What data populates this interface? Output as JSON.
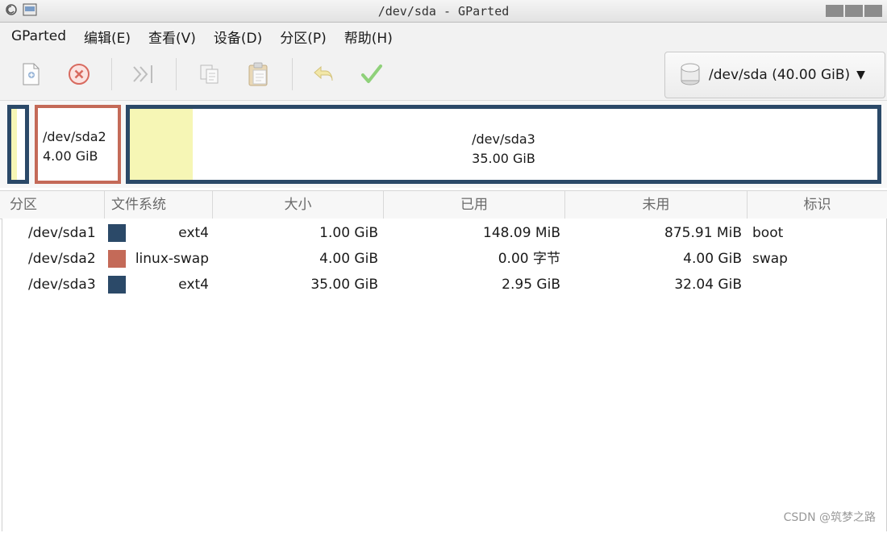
{
  "window": {
    "title": "/dev/sda - GParted"
  },
  "menu": {
    "items": [
      "GParted",
      "编辑(E)",
      "查看(V)",
      "设备(D)",
      "分区(P)",
      "帮助(H)"
    ]
  },
  "toolbar": {
    "buttons": [
      {
        "name": "new-partition",
        "icon": "new-icon"
      },
      {
        "name": "delete-partition",
        "icon": "delete-icon"
      },
      {
        "name": "resize-move",
        "icon": "resize-icon"
      },
      {
        "name": "copy",
        "icon": "copy-icon"
      },
      {
        "name": "paste",
        "icon": "paste-icon"
      },
      {
        "name": "undo",
        "icon": "undo-icon"
      },
      {
        "name": "apply",
        "icon": "apply-icon"
      }
    ]
  },
  "device": {
    "label": "/dev/sda (40.00 GiB)"
  },
  "disk_map": {
    "sda2": {
      "name": "/dev/sda2",
      "size": "4.00 GiB"
    },
    "sda3": {
      "name": "/dev/sda3",
      "size": "35.00 GiB"
    }
  },
  "columns": [
    "分区",
    "文件系统",
    "大小",
    "已用",
    "未用",
    "标识"
  ],
  "partitions": [
    {
      "partition": "/dev/sda1",
      "fs": "ext4",
      "color": "#2b4968",
      "size": "1.00 GiB",
      "used": "148.09 MiB",
      "unused": "875.91 MiB",
      "flags": "boot"
    },
    {
      "partition": "/dev/sda2",
      "fs": "linux-swap",
      "color": "#c46a58",
      "size": "4.00 GiB",
      "used": "0.00 字节",
      "unused": "4.00 GiB",
      "flags": "swap"
    },
    {
      "partition": "/dev/sda3",
      "fs": "ext4",
      "color": "#2b4968",
      "size": "35.00 GiB",
      "used": "2.95 GiB",
      "unused": "32.04 GiB",
      "flags": ""
    }
  ],
  "colors": {
    "ext4": "#2b4968",
    "swap": "#c46a58",
    "used_fill": "#f6f6b5"
  },
  "watermark": "CSDN @筑梦之路"
}
